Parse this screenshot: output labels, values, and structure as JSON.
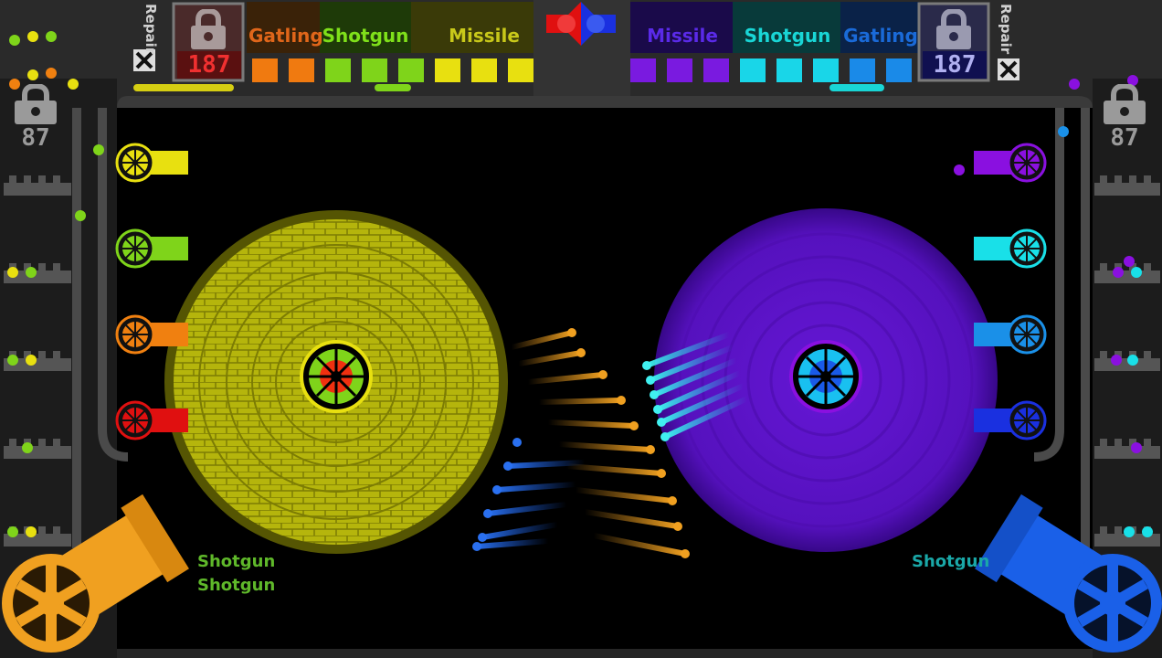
{
  "hud": {
    "left": {
      "repair_label": "Repair",
      "lock_count": "187",
      "side_lock_count": "87",
      "tabs": [
        {
          "label": "Gatling",
          "color": "#e0661a"
        },
        {
          "label": "Shotgun",
          "color": "#7fe01a"
        },
        {
          "label": "Missile",
          "color": "#c8c81a"
        }
      ],
      "ammo_colors": [
        "#f07a10",
        "#f07a10",
        "#7fd41a",
        "#7fd41a",
        "#7fd41a",
        "#e8e010",
        "#e8e010",
        "#e8e010"
      ]
    },
    "right": {
      "repair_label": "Repair",
      "lock_count": "187",
      "side_lock_count": "87",
      "tabs": [
        {
          "label": "Missile",
          "color": "#5a1ad8"
        },
        {
          "label": "Shotgun",
          "color": "#19d6d6"
        },
        {
          "label": "Gatling",
          "color": "#1a6ad8"
        }
      ],
      "ammo_colors": [
        "#7a1ae0",
        "#7a1ae0",
        "#7a1ae0",
        "#19d6e8",
        "#19d6e8",
        "#19d6e8",
        "#1a8ae8",
        "#1a8ae8"
      ]
    }
  },
  "players": {
    "left": {
      "cannons": [
        {
          "name": "yellow",
          "color": "#e8e010"
        },
        {
          "name": "green",
          "color": "#7fd41a"
        },
        {
          "name": "orange",
          "color": "#f08010"
        },
        {
          "name": "red",
          "color": "#e01010"
        }
      ],
      "main_cannon_color": "#f0a020",
      "shield_color": "#b8b80a",
      "core_color": "#f03010",
      "feed": [
        "Shotgun",
        "Shotgun"
      ],
      "feed_color": "#5fb82a"
    },
    "right": {
      "cannons": [
        {
          "name": "violet",
          "color": "#8a10e0"
        },
        {
          "name": "cyan",
          "color": "#19e0e8"
        },
        {
          "name": "sky",
          "color": "#1a90e8"
        },
        {
          "name": "blue",
          "color": "#1a30e0"
        }
      ],
      "main_cannon_color": "#1a60e8",
      "shield_color": "#5a12c8",
      "core_color": "#19c0f0",
      "feed": [
        "Shotgun"
      ],
      "feed_color": "#1aa8a8"
    }
  },
  "icons": {
    "lock": "padlock-icon",
    "repair": "hammer-wrench-icon",
    "center_emblem": "split-heart-emblem-icon"
  }
}
